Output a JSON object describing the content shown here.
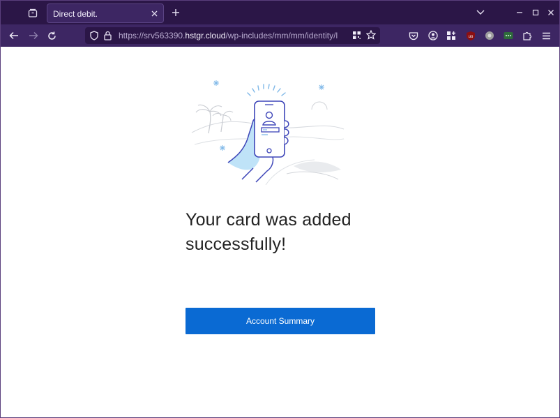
{
  "browser": {
    "tab": {
      "title": "Direct debit."
    },
    "url": {
      "prefix": "https://srv563390.",
      "host": "hstgr.cloud",
      "path": "/wp-includes/mm/mm/identity/l"
    }
  },
  "page": {
    "headline": "Your card was added successfully!",
    "primary_button": "Account Summary"
  },
  "colors": {
    "tabbar": "#2b1647",
    "navbar": "#3d2663",
    "button": "#0a6ad3",
    "illustration_line": "#3d45b8",
    "illustration_fill": "#bfe3f8"
  }
}
